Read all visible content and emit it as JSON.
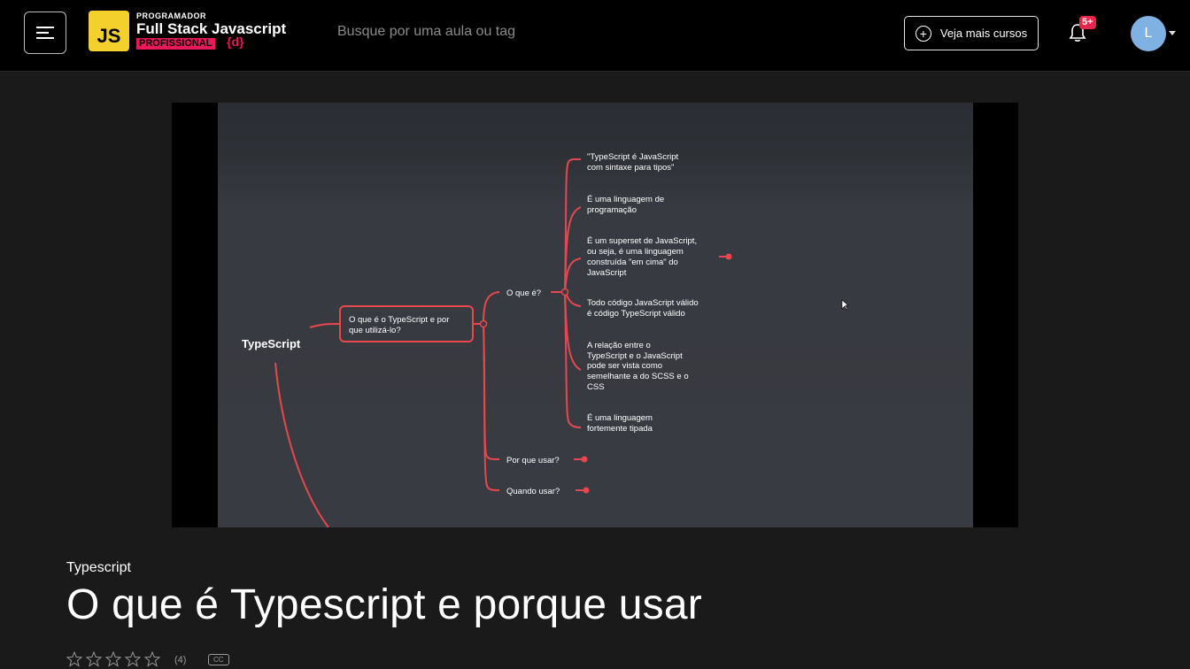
{
  "header": {
    "logo": {
      "badge": "JS",
      "top_line": "PROGRAMADOR",
      "main_line": "Full Stack Javascript",
      "pro_line": "PROFISSIONAL",
      "brace_text": "{d}"
    },
    "search_placeholder": "Busque por uma aula ou tag",
    "more_courses_label": "Veja mais cursos",
    "notification_badge": "5+",
    "avatar_initial": "L"
  },
  "video": {
    "mindmap": {
      "root": "TypeScript",
      "main_topic_line1": "O que é o TypeScript e por",
      "main_topic_line2": "que utilizá-lo?",
      "branch_what": "O que é?",
      "branch_why": "Por que usar?",
      "branch_when": "Quando usar?",
      "items": [
        {
          "lines": [
            "\"TypeScript é JavaScript",
            "com sintaxe para tipos\""
          ]
        },
        {
          "lines": [
            "É uma linguagem de",
            "programação"
          ]
        },
        {
          "lines": [
            "É um superset de JavaScript,",
            "ou seja, é uma linguagem",
            "construída \"em cima\" do",
            "JavaScript"
          ]
        },
        {
          "lines": [
            "Todo código JavaScript válido",
            "é código TypeScript válido"
          ]
        },
        {
          "lines": [
            "A relação entre o",
            "TypeScript e o JavaScript",
            "pode ser vista como",
            "semelhante a do SCSS e o",
            "CSS"
          ]
        },
        {
          "lines": [
            "É uma linguagem",
            "fortemente tipada"
          ]
        }
      ],
      "line_color": "#e8474e"
    }
  },
  "lesson": {
    "course": "Typescript",
    "title": "O que é Typescript e porque usar",
    "rating_count": "(4)",
    "cc_label": "CC"
  },
  "colors": {
    "topbar_bg": "#000000",
    "page_bg": "#1a1a1a",
    "badge_red": "#e8254a",
    "avatar_blue": "#7fb2e3",
    "logo_yellow": "#f3d02b",
    "logo_pink": "#e8185b"
  }
}
